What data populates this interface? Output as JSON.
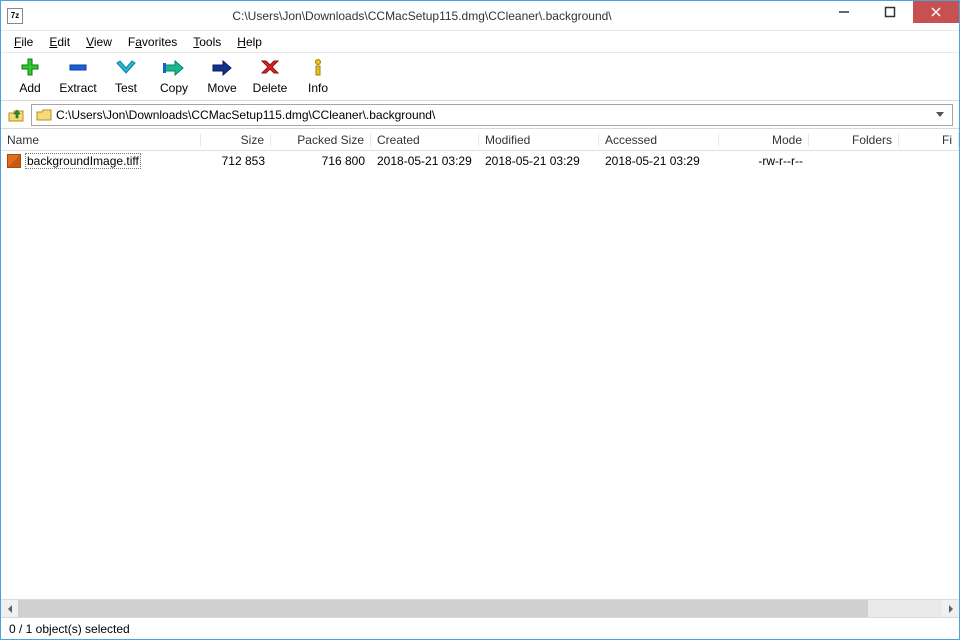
{
  "window": {
    "title": "C:\\Users\\Jon\\Downloads\\CCMacSetup115.dmg\\CCleaner\\.background\\",
    "app_glyph": "7z"
  },
  "menubar": {
    "items": [
      {
        "u": "F",
        "rest": "ile"
      },
      {
        "u": "E",
        "rest": "dit"
      },
      {
        "u": "V",
        "rest": "iew"
      },
      {
        "u": "F",
        "rest": "avorites",
        "pre": "",
        "idx": 0,
        "alt_u": "a",
        "alt_pre": "F",
        "alt_rest": "vorites"
      },
      {
        "u": "T",
        "rest": "ools"
      },
      {
        "u": "H",
        "rest": "elp"
      }
    ],
    "file": "File",
    "edit": "Edit",
    "view": "View",
    "favorites": "Favorites",
    "tools": "Tools",
    "help": "Help"
  },
  "toolbar": {
    "add": "Add",
    "extract": "Extract",
    "test": "Test",
    "copy": "Copy",
    "move": "Move",
    "delete": "Delete",
    "info": "Info"
  },
  "address": {
    "path": "C:\\Users\\Jon\\Downloads\\CCMacSetup115.dmg\\CCleaner\\.background\\"
  },
  "columns": {
    "name": "Name",
    "size": "Size",
    "packed": "Packed Size",
    "created": "Created",
    "modified": "Modified",
    "accessed": "Accessed",
    "mode": "Mode",
    "folders": "Folders",
    "files": "Fi"
  },
  "rows": [
    {
      "name": "backgroundImage.tiff",
      "size": "712 853",
      "packed": "716 800",
      "created": "2018-05-21 03:29",
      "modified": "2018-05-21 03:29",
      "accessed": "2018-05-21 03:29",
      "mode": "-rw-r--r--",
      "folders": "",
      "files": ""
    }
  ],
  "status": {
    "text": "0 / 1 object(s) selected"
  }
}
